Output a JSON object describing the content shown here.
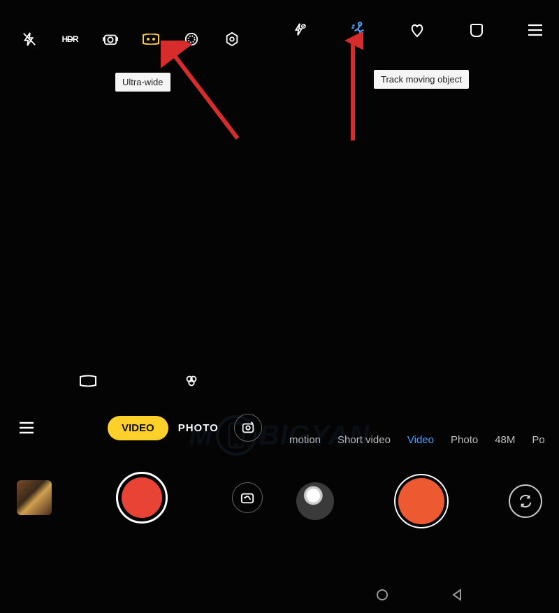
{
  "left": {
    "toolbar": {
      "flash": "flash-off",
      "hdr": "HDR",
      "chroma": "chroma-boost",
      "ultrawide": "ultrawide",
      "filter": "filter",
      "shape": "dazzle"
    },
    "tooltip": "Ultra-wide",
    "sec_icons": {
      "pano": "panorama-icon",
      "filters": "filters-icon"
    },
    "modes": {
      "hamburger": "menu",
      "video": "VIDEO",
      "photo": "PHOTO",
      "ai": "ai-scene"
    },
    "shutter": {
      "thumb": "gallery-thumbnail",
      "button": "record-button",
      "switch": "switch-camera"
    }
  },
  "right": {
    "toolbar": {
      "flash": "flash-off",
      "track": "track-moving",
      "beauty": "beauty",
      "filter": "filter",
      "menu": "menu"
    },
    "tooltip": "Track moving object",
    "modes": {
      "items": [
        "motion",
        "Short video",
        "Video",
        "Photo",
        "48M",
        "Po"
      ],
      "active_index": 2
    },
    "shutter": {
      "thumb": "gallery-thumbnail",
      "button": "record-button",
      "switch": "switch-camera"
    },
    "nav": {
      "home": "home",
      "back": "back"
    }
  },
  "watermark": {
    "left": "M",
    "phone": "phone",
    "right": "BIGYAN"
  }
}
